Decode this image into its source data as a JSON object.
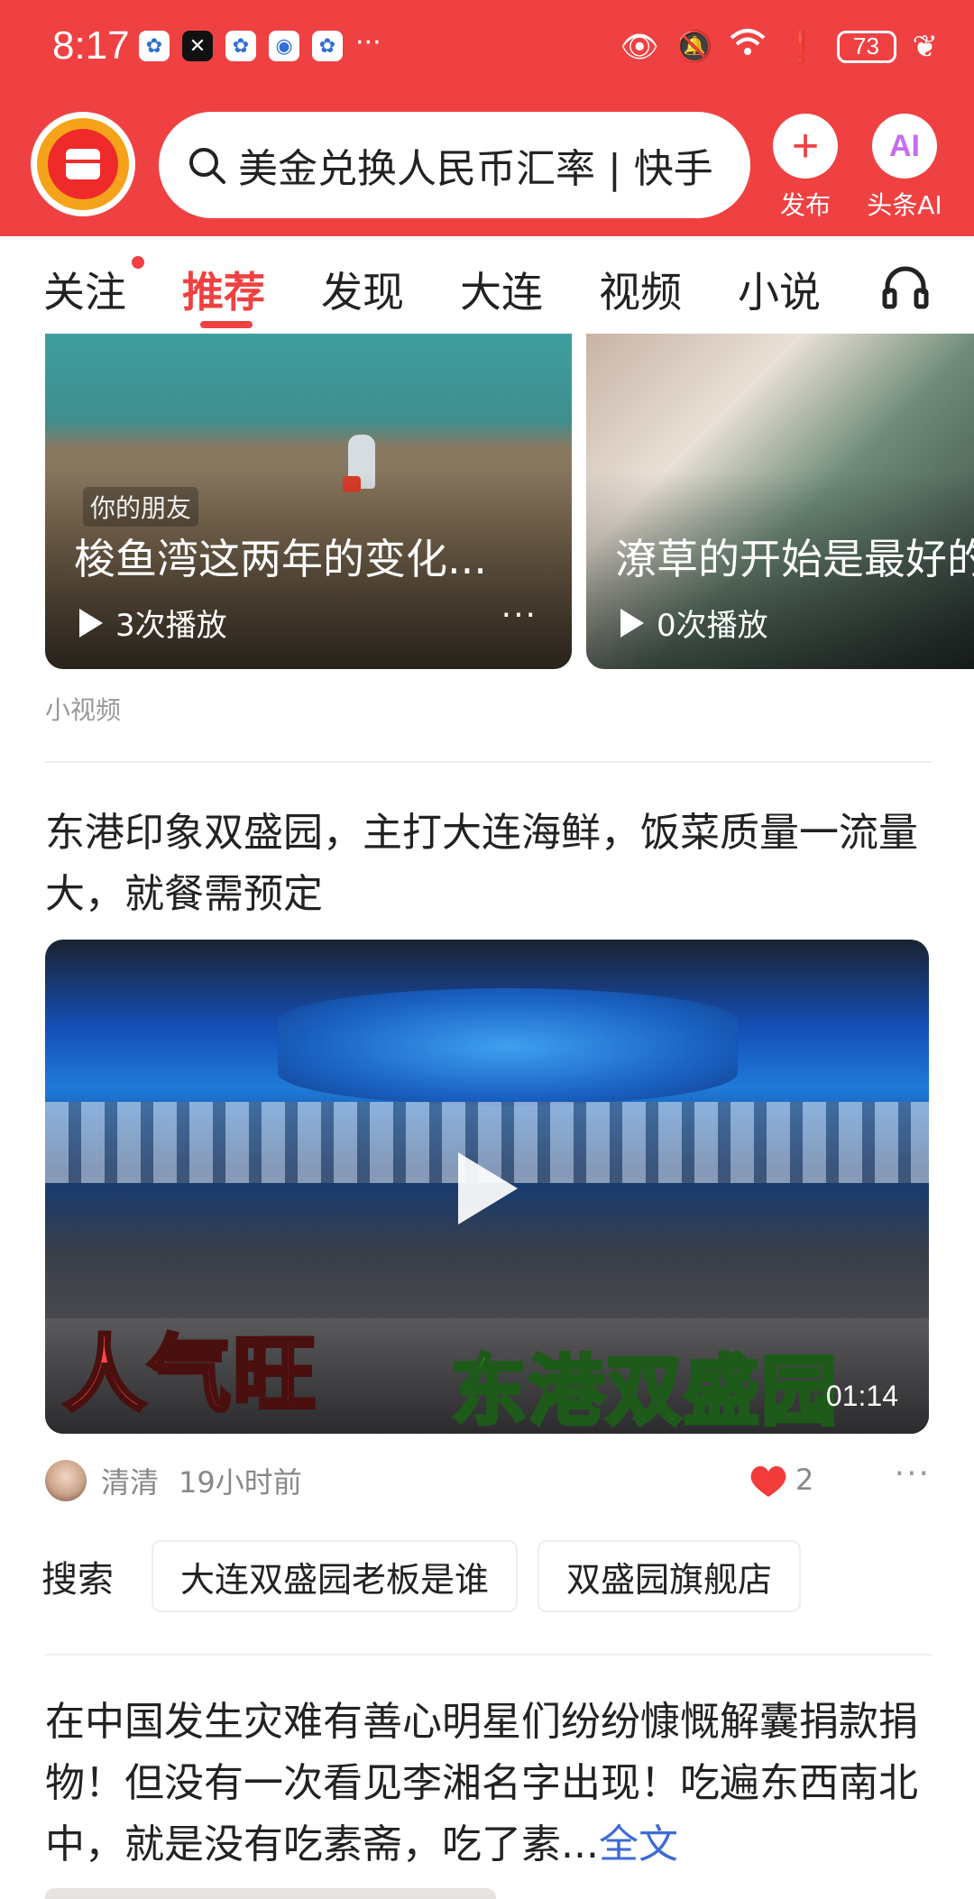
{
  "status_bar": {
    "time": "8:17",
    "notification_icons": [
      "baidu-icon",
      "capcut-icon",
      "baidu-icon",
      "browser-icon",
      "baidu-icon"
    ],
    "more": "···",
    "battery": "73"
  },
  "header": {
    "search_placeholder": "美金兑换人民币汇率 | 快手",
    "publish_label": "发布",
    "publish_icon": "+",
    "ai_label": "头条AI",
    "ai_icon": "AI"
  },
  "tabs": [
    {
      "label": "关注",
      "has_dot": true
    },
    {
      "label": "推荐",
      "active": true
    },
    {
      "label": "发现"
    },
    {
      "label": "大连"
    },
    {
      "label": "视频"
    },
    {
      "label": "小说"
    }
  ],
  "small_videos": {
    "section_label": "小视频",
    "cards": [
      {
        "badge": "你的朋友",
        "title": "梭鱼湾这两年的变化...",
        "plays": "3次播放",
        "more": "···"
      },
      {
        "title": "潦草的开始是最好的",
        "plays": "0次播放"
      }
    ]
  },
  "article1": {
    "title": "东港印象双盛园，主打大连海鲜，饭菜质量一流量大，就餐需预定",
    "caption_red": "人气旺",
    "caption_green": "东港双盛园",
    "duration": "01:14",
    "author": "清清",
    "time_ago": "19小时前",
    "likes": "2",
    "more": "···"
  },
  "search_suggest": {
    "label": "搜索",
    "chips": [
      "大连双盛园老板是谁",
      "双盛园旗舰店"
    ]
  },
  "article2": {
    "title": "在中国发生灾难有善心明星们纷纷慷慨解囊捐款捐物！但没有一次看见李湘名字出现！吃遍东西南北中，就是没有吃素斋，吃了素...",
    "full_text_link": "全文"
  },
  "colors": {
    "brand_red": "#f04142",
    "link_blue": "#3d6ad6"
  }
}
